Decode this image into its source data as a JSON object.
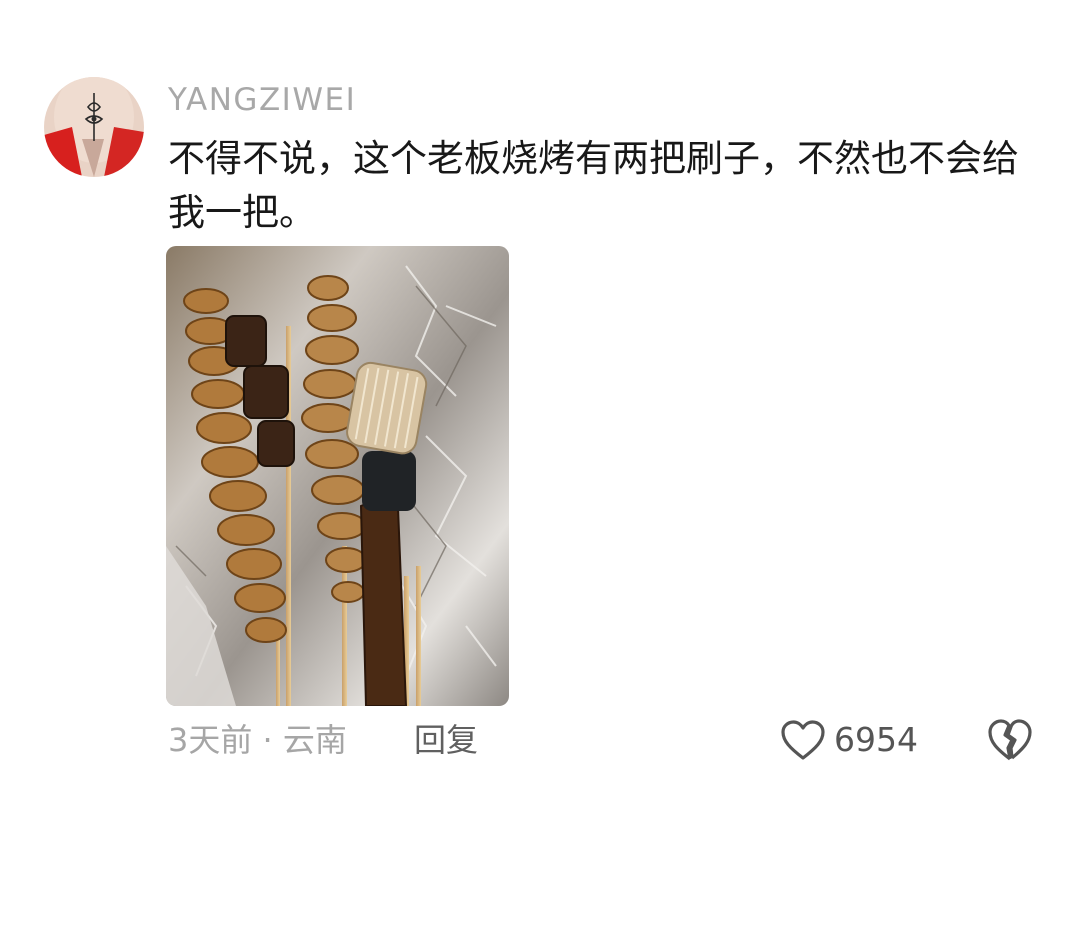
{
  "comment": {
    "username": "YANGZIWEI",
    "text": "不得不说，这个老板烧烤有两把刷子，不然也不会给我一把。",
    "time": "3天前",
    "separator": "·",
    "location": "云南",
    "reply_label": "回复",
    "likes": "6954",
    "icons": {
      "like": "heart-outline-icon",
      "dislike": "broken-heart-icon"
    },
    "colors": {
      "username": "#a8a8a8",
      "text": "#181818",
      "meta": "#a6a6a6",
      "reply": "#606060",
      "icon": "#555555",
      "avatar_accent": "#d7201e"
    }
  }
}
